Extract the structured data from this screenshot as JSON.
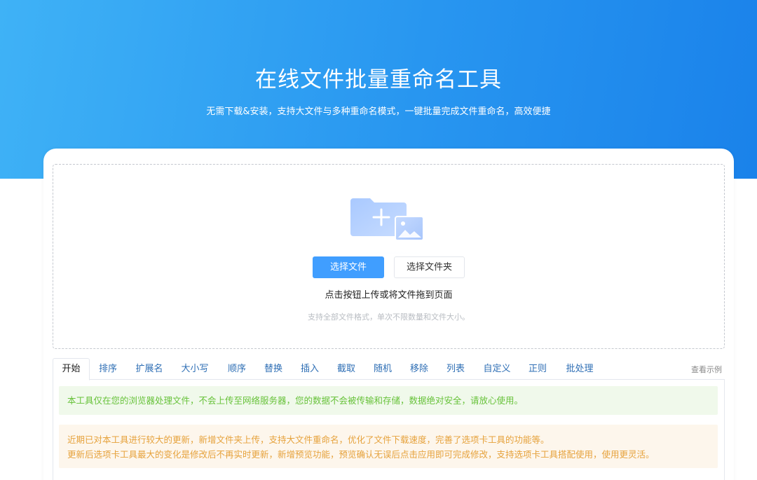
{
  "hero": {
    "title": "在线文件批量重命名工具",
    "subtitle": "无需下载&安装，支持大文件与多种重命名模式，一键批量完成文件重命名，高效便捷"
  },
  "upload": {
    "select_file_label": "选择文件",
    "select_folder_label": "选择文件夹",
    "hint": "点击按钮上传或将文件拖到页面",
    "sub_hint": "支持全部文件格式，单次不限数量和文件大小。",
    "icon": "folder-upload-icon"
  },
  "tabs": {
    "items": [
      {
        "label": "开始",
        "active": true
      },
      {
        "label": "排序"
      },
      {
        "label": "扩展名"
      },
      {
        "label": "大小写"
      },
      {
        "label": "顺序"
      },
      {
        "label": "替换"
      },
      {
        "label": "插入"
      },
      {
        "label": "截取"
      },
      {
        "label": "随机"
      },
      {
        "label": "移除"
      },
      {
        "label": "列表"
      },
      {
        "label": "自定义"
      },
      {
        "label": "正则"
      },
      {
        "label": "批处理"
      }
    ],
    "example_link": "查看示例"
  },
  "notices": {
    "success": "本工具仅在您的浏览器处理文件，不会上传至网络服务器，您的数据不会被传输和存储，数据绝对安全，请放心使用。",
    "update_line1": "近期已对本工具进行较大的更新，新增文件夹上传，支持大文件重命名，优化了文件下载速度，完善了选项卡工具的功能等。",
    "update_line2": "更新后选项卡工具最大的变化是修改后不再实时更新，新增预览功能，预览确认无误后点击应用即可完成修改，支持选项卡工具搭配使用，使用更灵活。"
  },
  "colors": {
    "primary": "#409eff",
    "hero_start": "#3fb2f6",
    "hero_end": "#1a82ea",
    "success_text": "#67c23a",
    "warning_text": "#e6a23c"
  }
}
